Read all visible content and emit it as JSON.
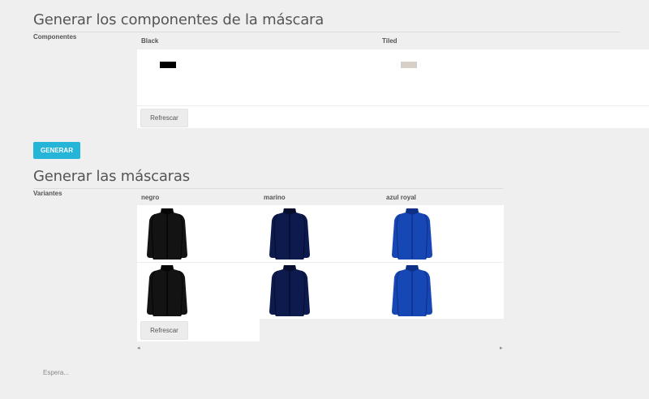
{
  "components": {
    "title": "Generar los componentes de la máscara",
    "side_label": "Componentes",
    "columns": [
      {
        "name": "Black",
        "color": "#000000"
      },
      {
        "name": "Tiled",
        "color": "#d8cfc6"
      }
    ],
    "refresh_label": "Refrescar"
  },
  "generate_label": "GENERAR",
  "masks": {
    "title": "Generar las máscaras",
    "side_label": "Variantes",
    "variants": [
      {
        "name": "negro",
        "body": "#131313",
        "shade": "#050505"
      },
      {
        "name": "marino",
        "body": "#0d1a4d",
        "shade": "#060d2e"
      },
      {
        "name": "azul royal",
        "body": "#1747b5",
        "shade": "#0d2f86"
      }
    ],
    "refresh_label": "Refrescar"
  },
  "status_text": "Espera..."
}
